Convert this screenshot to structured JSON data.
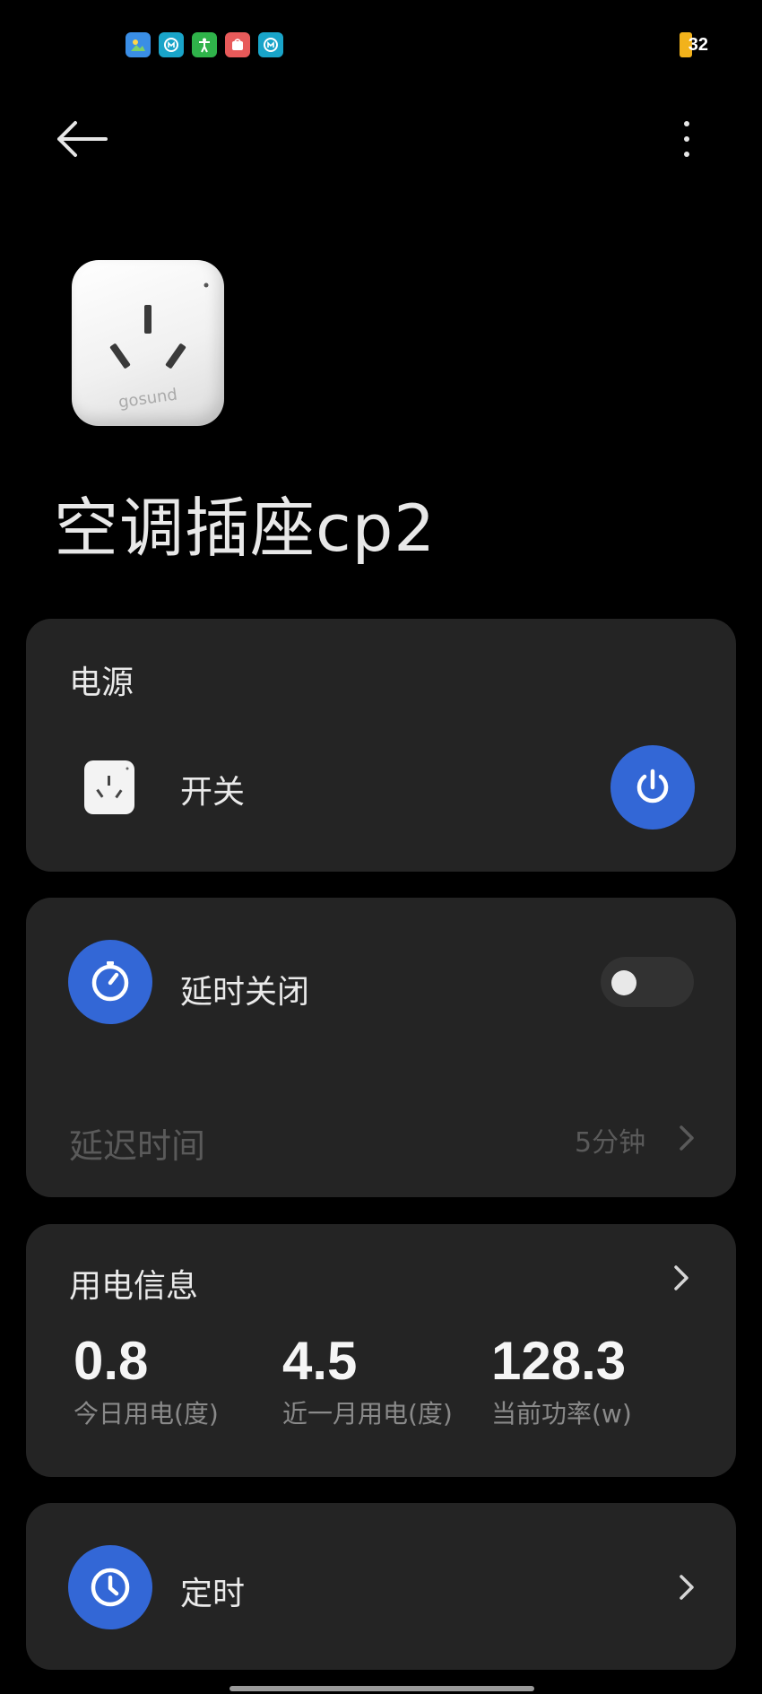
{
  "status_bar": {
    "app_icons": [
      "photos-app-icon",
      "mi-app-icon",
      "accessibility-app-icon",
      "store-app-icon",
      "mi-app-icon-2"
    ],
    "battery_level": "32"
  },
  "header": {
    "back_icon": "arrow-left-icon",
    "more_icon": "more-vertical-icon"
  },
  "device": {
    "name": "空调插座cp2",
    "image_brand": "gosund"
  },
  "power_card": {
    "title": "电源",
    "switch_label": "开关",
    "switch_icon": "power-icon",
    "switch_on": true
  },
  "delay_card": {
    "label": "延时关闭",
    "icon": "timer-gauge-icon",
    "toggle_on": false,
    "delay_label": "延迟时间",
    "delay_value": "5分钟"
  },
  "usage_card": {
    "title": "用电信息",
    "stats": [
      {
        "value": "0.8",
        "label": "今日用电(度)"
      },
      {
        "value": "4.5",
        "label": "近一月用电(度)"
      },
      {
        "value": "128.3",
        "label": "当前功率(w)"
      }
    ]
  },
  "timer_card": {
    "label": "定时",
    "icon": "clock-icon"
  },
  "colors": {
    "accent": "#3367d6",
    "card_bg": "#242424",
    "background": "#000000",
    "battery": "#f2b21b"
  }
}
